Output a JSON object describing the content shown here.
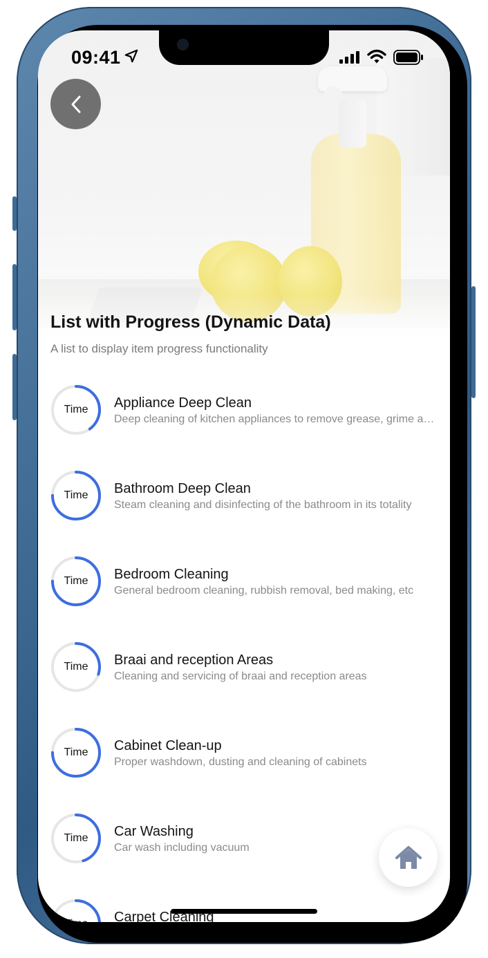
{
  "status_bar": {
    "time": "09:41"
  },
  "header": {
    "title": "List with Progress (Dynamic Data)",
    "subtitle": "A list to display item progress functionality"
  },
  "colors": {
    "accent": "#3d6ee0",
    "track": "#e6e6e6",
    "fab_icon": "#7b8aa6"
  },
  "items": [
    {
      "label": "Time",
      "title": "Appliance Deep Clean",
      "desc": "Deep cleaning of kitchen appliances to remove grease, grime and dirt",
      "progress": 0.4
    },
    {
      "label": "Time",
      "title": "Bathroom Deep Clean",
      "desc": "Steam cleaning and disinfecting of the bathroom in its totality",
      "progress": 0.75
    },
    {
      "label": "Time",
      "title": "Bedroom Cleaning",
      "desc": "General bedroom cleaning, rubbish removal, bed making, etc",
      "progress": 0.75
    },
    {
      "label": "Time",
      "title": "Braai and reception Areas",
      "desc": "Cleaning and servicing of braai and reception areas",
      "progress": 0.3
    },
    {
      "label": "Time",
      "title": "Cabinet Clean-up",
      "desc": "Proper washdown, dusting and cleaning of cabinets",
      "progress": 0.75
    },
    {
      "label": "Time",
      "title": "Car Washing",
      "desc": "Car wash including vacuum",
      "progress": 0.45
    },
    {
      "label": "Time",
      "title": "Carpet Cleaning",
      "desc": "",
      "progress": 0.4
    }
  ],
  "icons": {
    "back": "chevron-left-icon",
    "fab": "home-icon",
    "location": "location-arrow-icon"
  }
}
